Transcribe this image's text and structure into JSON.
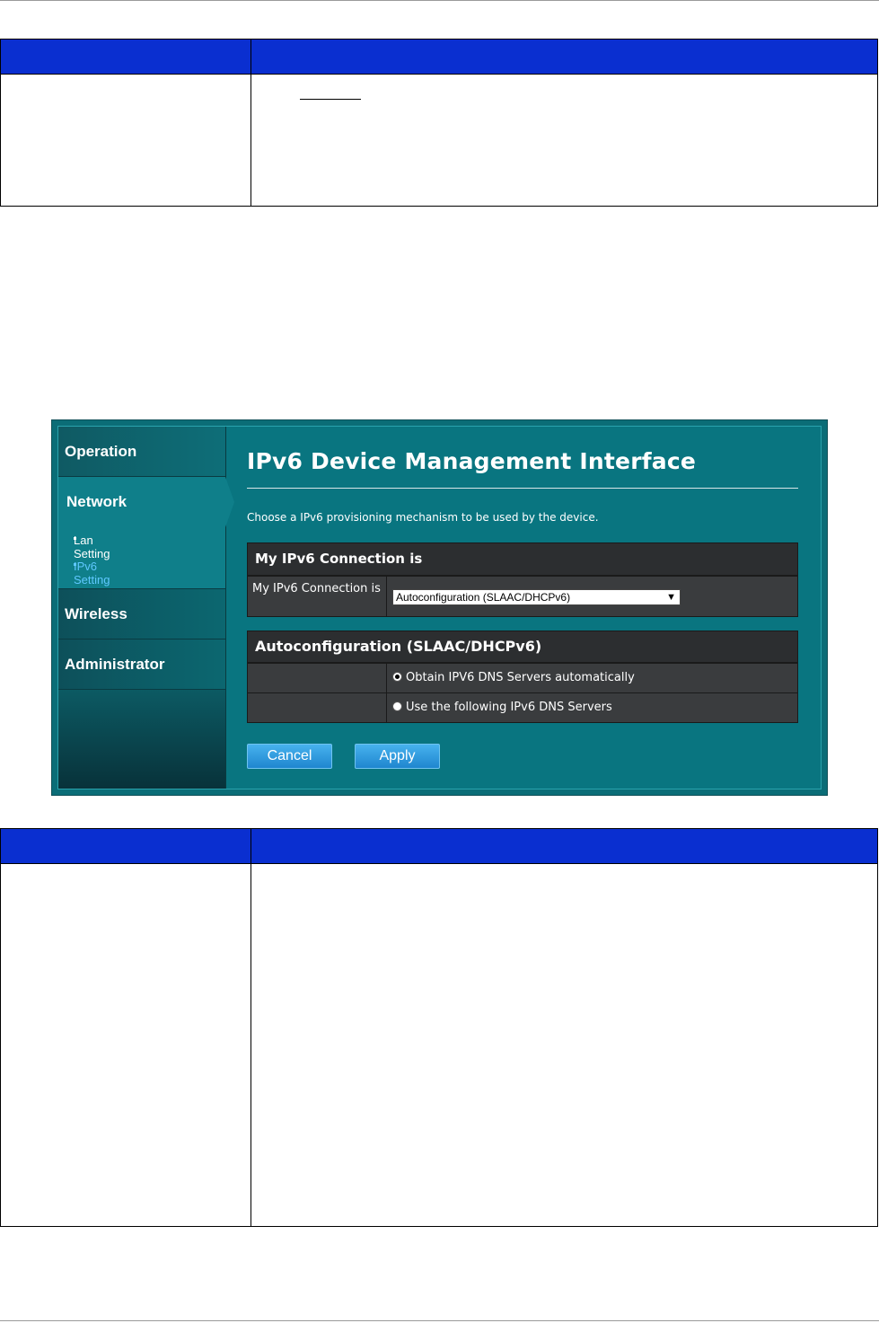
{
  "ui": {
    "sidebar": {
      "operation": "Operation",
      "network": "Network",
      "lan_setting": "Lan Setting",
      "ipv6_setting": "IPv6 Setting",
      "wireless": "Wireless",
      "administrator": "Administrator"
    },
    "title": "IPv6 Device Management Interface",
    "description": "Choose a IPv6 provisioning mechanism to be used by the device.",
    "connection_panel": {
      "header": "My IPv6 Connection is",
      "row_label": "My IPv6 Connection is",
      "select_value": "Autoconfiguration (SLAAC/DHCPv6)"
    },
    "auto_panel": {
      "header": "Autoconfiguration (SLAAC/DHCPv6)",
      "option_auto": "Obtain IPV6 DNS Servers automatically",
      "option_manual": "Use the following IPv6 DNS Servers",
      "selected": "auto"
    },
    "buttons": {
      "cancel": "Cancel",
      "apply": "Apply"
    }
  },
  "colors": {
    "table_header": "#0a2fd0",
    "ui_background": "#097580",
    "active_link": "#5fc8ff"
  }
}
